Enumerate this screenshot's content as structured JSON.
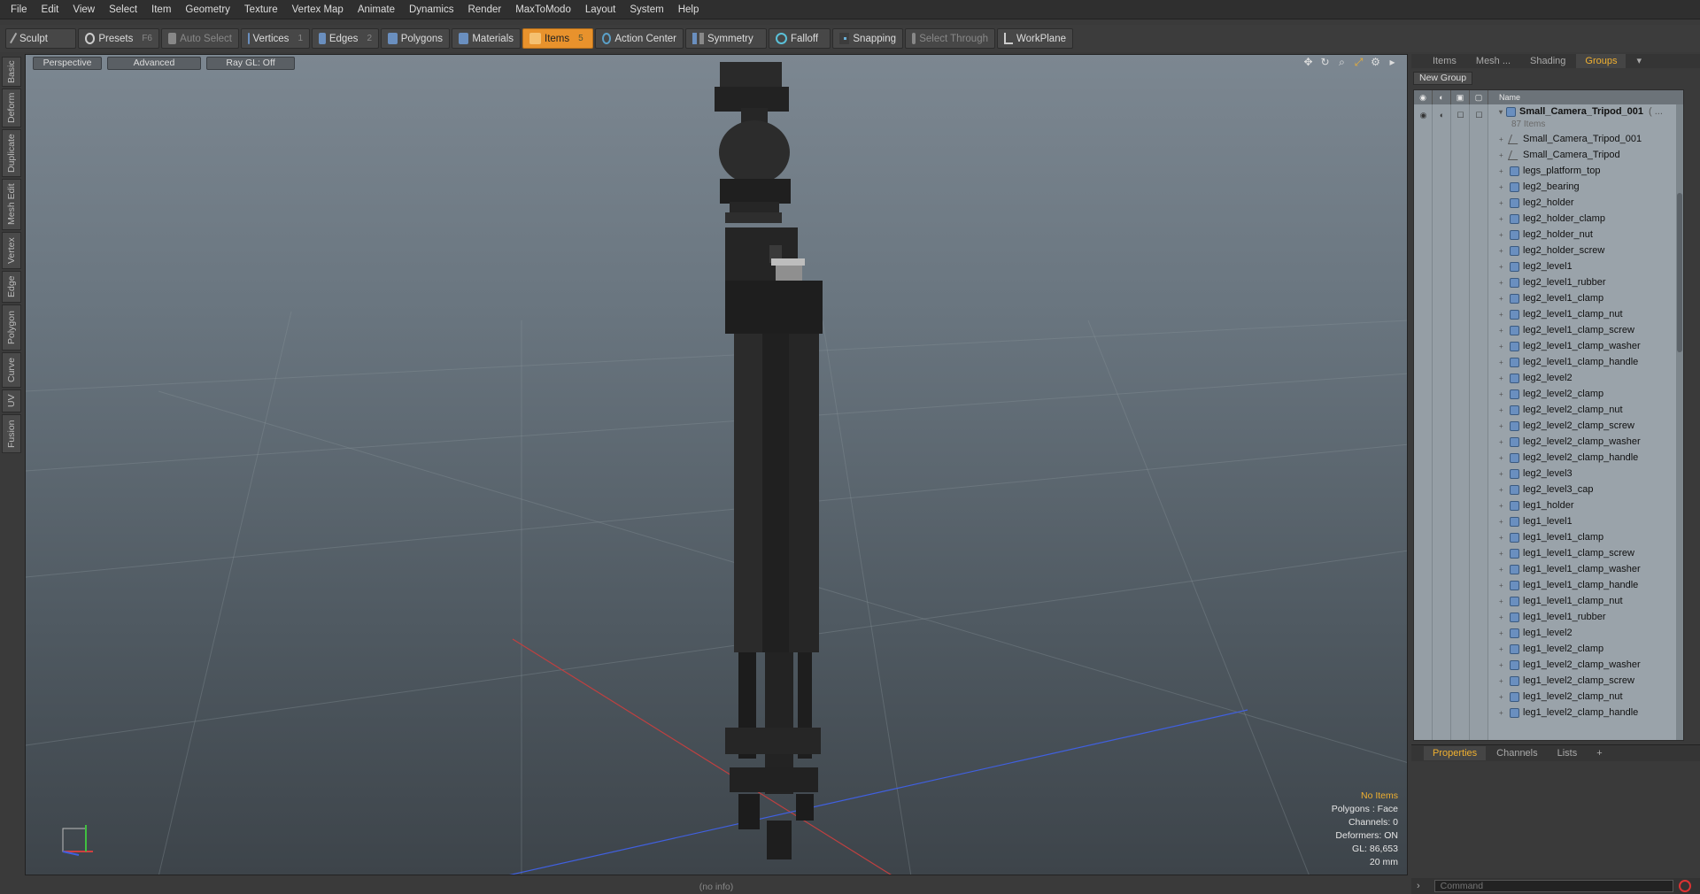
{
  "menu": [
    "File",
    "Edit",
    "View",
    "Select",
    "Item",
    "Geometry",
    "Texture",
    "Vertex Map",
    "Animate",
    "Dynamics",
    "Render",
    "MaxToModo",
    "Layout",
    "System",
    "Help"
  ],
  "toolbar": {
    "sculpt": "Sculpt",
    "presets": "Presets",
    "presets_key": "F6",
    "auto_select": "Auto Select",
    "vertices": "Vertices",
    "vertices_key": "1",
    "edges": "Edges",
    "edges_key": "2",
    "polygons": "Polygons",
    "materials": "Materials",
    "items": "Items",
    "items_key": "5",
    "action_center": "Action Center",
    "symmetry": "Symmetry",
    "falloff": "Falloff",
    "snapping": "Snapping",
    "select_through": "Select Through",
    "workplane": "WorkPlane"
  },
  "left_tabs": [
    "Basic",
    "Deform",
    "Duplicate",
    "Mesh Edit",
    "Vertex",
    "Edge",
    "Polygon",
    "Curve",
    "UV",
    "Fusion"
  ],
  "viewport": {
    "perspective": "Perspective",
    "advanced": "Advanced",
    "raygl": "Ray GL: Off",
    "stats": {
      "selection": "No Items",
      "polygons": "Polygons : Face",
      "channels": "Channels: 0",
      "deformers": "Deformers: ON",
      "gl": "GL: 86,653",
      "scale": "20 mm"
    }
  },
  "statusbar": "(no info)",
  "right_panel": {
    "tabs": [
      "Items",
      "Mesh ...",
      "Shading",
      "Groups"
    ],
    "active_tab": "Groups",
    "new_group": "New Group",
    "name_header": "Name",
    "root": {
      "name": "Small_Camera_Tripod_001",
      "suffix": "( ...",
      "count": "87 Items"
    },
    "items": [
      {
        "name": "Small_Camera_Tripod_001",
        "icon": "locator-icon"
      },
      {
        "name": "Small_Camera_Tripod",
        "icon": "locator-icon"
      },
      {
        "name": "legs_platform_top",
        "icon": "mesh-icon"
      },
      {
        "name": "leg2_bearing",
        "icon": "mesh-icon"
      },
      {
        "name": "leg2_holder",
        "icon": "mesh-icon"
      },
      {
        "name": "leg2_holder_clamp",
        "icon": "mesh-icon"
      },
      {
        "name": "leg2_holder_nut",
        "icon": "mesh-icon"
      },
      {
        "name": "leg2_holder_screw",
        "icon": "mesh-icon"
      },
      {
        "name": "leg2_level1",
        "icon": "mesh-icon"
      },
      {
        "name": "leg2_level1_rubber",
        "icon": "mesh-icon"
      },
      {
        "name": "leg2_level1_clamp",
        "icon": "mesh-icon"
      },
      {
        "name": "leg2_level1_clamp_nut",
        "icon": "mesh-icon"
      },
      {
        "name": "leg2_level1_clamp_screw",
        "icon": "mesh-icon"
      },
      {
        "name": "leg2_level1_clamp_washer",
        "icon": "mesh-icon"
      },
      {
        "name": "leg2_level1_clamp_handle",
        "icon": "mesh-icon"
      },
      {
        "name": "leg2_level2",
        "icon": "mesh-icon"
      },
      {
        "name": "leg2_level2_clamp",
        "icon": "mesh-icon"
      },
      {
        "name": "leg2_level2_clamp_nut",
        "icon": "mesh-icon"
      },
      {
        "name": "leg2_level2_clamp_screw",
        "icon": "mesh-icon"
      },
      {
        "name": "leg2_level2_clamp_washer",
        "icon": "mesh-icon"
      },
      {
        "name": "leg2_level2_clamp_handle",
        "icon": "mesh-icon"
      },
      {
        "name": "leg2_level3",
        "icon": "mesh-icon"
      },
      {
        "name": "leg2_level3_cap",
        "icon": "mesh-icon"
      },
      {
        "name": "leg1_holder",
        "icon": "mesh-icon"
      },
      {
        "name": "leg1_level1",
        "icon": "mesh-icon"
      },
      {
        "name": "leg1_level1_clamp",
        "icon": "mesh-icon"
      },
      {
        "name": "leg1_level1_clamp_screw",
        "icon": "mesh-icon"
      },
      {
        "name": "leg1_level1_clamp_washer",
        "icon": "mesh-icon"
      },
      {
        "name": "leg1_level1_clamp_handle",
        "icon": "mesh-icon"
      },
      {
        "name": "leg1_level1_clamp_nut",
        "icon": "mesh-icon"
      },
      {
        "name": "leg1_level1_rubber",
        "icon": "mesh-icon"
      },
      {
        "name": "leg1_level2",
        "icon": "mesh-icon"
      },
      {
        "name": "leg1_level2_clamp",
        "icon": "mesh-icon"
      },
      {
        "name": "leg1_level2_clamp_washer",
        "icon": "mesh-icon"
      },
      {
        "name": "leg1_level2_clamp_screw",
        "icon": "mesh-icon"
      },
      {
        "name": "leg1_level2_clamp_nut",
        "icon": "mesh-icon"
      },
      {
        "name": "leg1_level2_clamp_handle",
        "icon": "mesh-icon"
      }
    ]
  },
  "props_panel": {
    "tabs": [
      "Properties",
      "Channels",
      "Lists",
      "+"
    ],
    "active_tab": "Properties"
  },
  "command": {
    "placeholder": "Command"
  },
  "colors": {
    "accent": "#e8922c",
    "active_text": "#f0b030",
    "axis_x": "#d04040",
    "axis_y": "#40c040",
    "axis_z": "#4060e0"
  }
}
